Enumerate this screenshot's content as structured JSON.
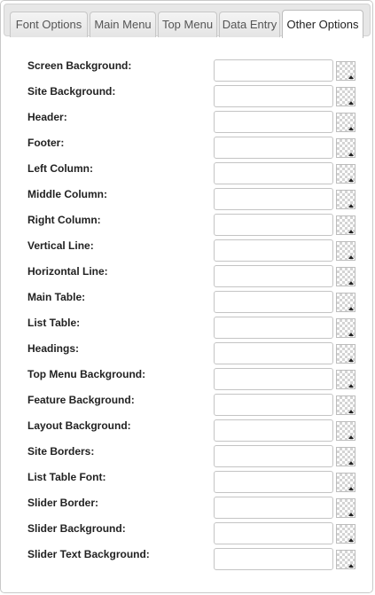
{
  "tabs": [
    {
      "label": "Font Options",
      "active": false
    },
    {
      "label": "Main Menu",
      "active": false
    },
    {
      "label": "Top Menu",
      "active": false
    },
    {
      "label": "Data Entry",
      "active": false
    },
    {
      "label": "Other Options",
      "active": true
    }
  ],
  "fields": [
    {
      "label": "Screen Background:",
      "value": ""
    },
    {
      "label": "Site Background:",
      "value": ""
    },
    {
      "label": "Header:",
      "value": ""
    },
    {
      "label": "Footer:",
      "value": ""
    },
    {
      "label": "Left Column:",
      "value": ""
    },
    {
      "label": "Middle Column:",
      "value": ""
    },
    {
      "label": "Right Column:",
      "value": ""
    },
    {
      "label": "Vertical Line:",
      "value": ""
    },
    {
      "label": "Horizontal Line:",
      "value": ""
    },
    {
      "label": "Main Table:",
      "value": ""
    },
    {
      "label": "List Table:",
      "value": ""
    },
    {
      "label": "Headings:",
      "value": ""
    },
    {
      "label": "Top Menu Background:",
      "value": ""
    },
    {
      "label": "Feature Background:",
      "value": ""
    },
    {
      "label": "Layout Background:",
      "value": ""
    },
    {
      "label": "Site Borders:",
      "value": ""
    },
    {
      "label": "List Table Font:",
      "value": ""
    },
    {
      "label": "Slider Border:",
      "value": ""
    },
    {
      "label": "Slider Background:",
      "value": ""
    },
    {
      "label": "Slider Text Background:",
      "value": ""
    }
  ],
  "icons": {
    "picker": "color-picker-icon",
    "arrow": "dropdown-arrow-icon"
  },
  "colors": {
    "active_tab": "#ffffff",
    "inactive_tab": "#e9e9e9",
    "tab_bar": "#e7e7e7",
    "label_text": "#222222"
  }
}
